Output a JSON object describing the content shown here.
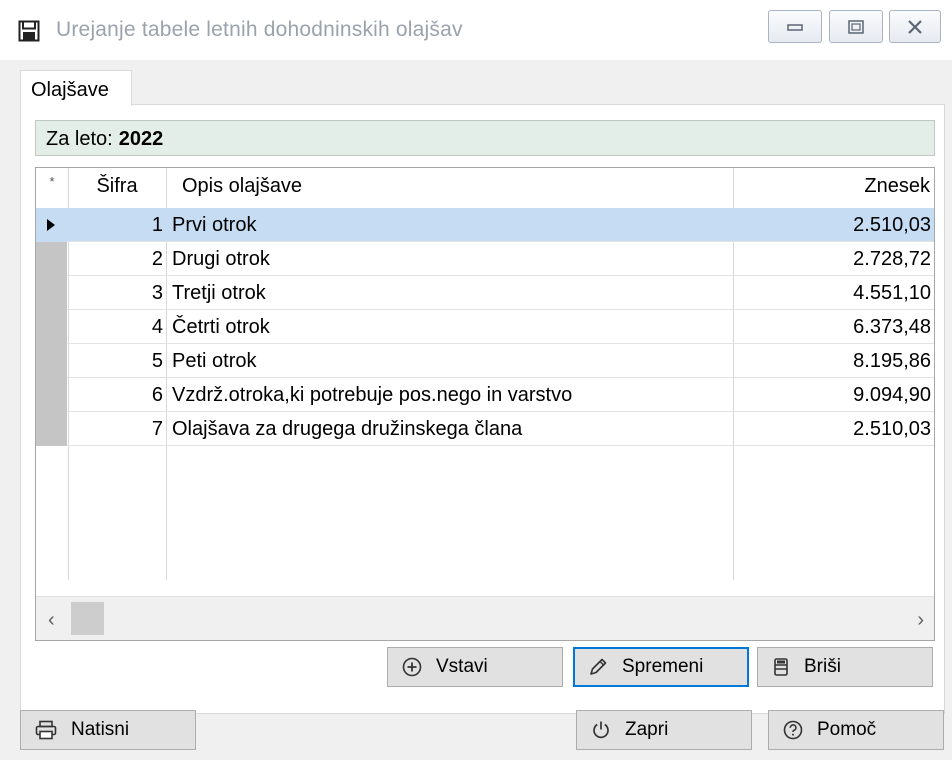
{
  "window": {
    "title": "Urejanje tabele letnih dohodninskih olajšav"
  },
  "tabs": [
    {
      "label": "Olajšave",
      "active": true
    }
  ],
  "year_filter": {
    "label": "Za leto:",
    "value": "2022"
  },
  "grid": {
    "marker_header": "*",
    "columns": [
      "Šifra",
      "Opis olajšave",
      "Znesek"
    ],
    "rows": [
      {
        "sifra": "1",
        "opis": "Prvi otrok",
        "znesek": "2.510,03",
        "selected": true
      },
      {
        "sifra": "2",
        "opis": "Drugi otrok",
        "znesek": "2.728,72"
      },
      {
        "sifra": "3",
        "opis": "Tretji otrok",
        "znesek": "4.551,10"
      },
      {
        "sifra": "4",
        "opis": "Četrti otrok",
        "znesek": "6.373,48"
      },
      {
        "sifra": "5",
        "opis": "Peti otrok",
        "znesek": "8.195,86"
      },
      {
        "sifra": "6",
        "opis": "Vzdrž.otroka,ki potrebuje pos.nego in varstvo",
        "znesek": "9.094,90"
      },
      {
        "sifra": "7",
        "opis": "Olajšava za drugega družinskega člana",
        "znesek": "2.510,03"
      }
    ]
  },
  "buttons": {
    "insert": "Vstavi",
    "edit": "Spremeni",
    "delete": "Briši",
    "print": "Natisni",
    "close": "Zapri",
    "help": "Pomoč"
  },
  "colors": {
    "selected_row": "#c5dcf3",
    "year_box_bg": "#e4eee8",
    "focus_border": "#0078d7"
  },
  "icons": {
    "title": "save-icon",
    "insert": "plus-circle-icon",
    "edit": "pencil-icon",
    "delete": "trash-icon",
    "print": "printer-icon",
    "close": "power-icon",
    "help": "question-circle-icon"
  }
}
